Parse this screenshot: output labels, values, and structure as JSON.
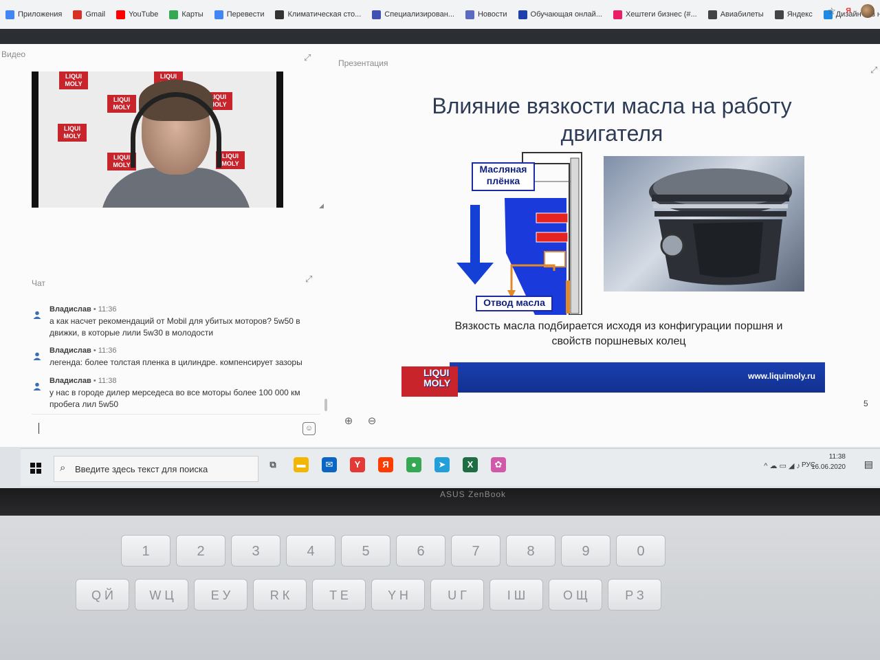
{
  "bookmarks": {
    "items": [
      {
        "label": "Приложения",
        "icon": "apps-grid-icon",
        "color": "#4285f4"
      },
      {
        "label": "Gmail",
        "icon": "gmail-icon",
        "color": "#d93025"
      },
      {
        "label": "YouTube",
        "icon": "youtube-icon",
        "color": "#ff0000"
      },
      {
        "label": "Карты",
        "icon": "maps-icon",
        "color": "#34a853"
      },
      {
        "label": "Перевести",
        "icon": "translate-icon",
        "color": "#4285f4"
      },
      {
        "label": "Климатическая сто...",
        "icon": "site-icon",
        "color": "#333333"
      },
      {
        "label": "Специализирован...",
        "icon": "site-icon",
        "color": "#3f51b5"
      },
      {
        "label": "Новости",
        "icon": "news-icon",
        "color": "#5c6bc0"
      },
      {
        "label": "Обучающая онлай...",
        "icon": "site-icon",
        "color": "#1e40af"
      },
      {
        "label": "Хештеги бизнес (#...",
        "icon": "site-icon",
        "color": "#e91e63"
      },
      {
        "label": "Авиабилеты",
        "icon": "globe-icon",
        "color": "#444444"
      },
      {
        "label": "Яндекс",
        "icon": "globe-icon",
        "color": "#444444"
      },
      {
        "label": "Дизайн без назван...",
        "icon": "canva-icon",
        "color": "#1e88e5"
      }
    ],
    "extension_label": "Я"
  },
  "video_panel": {
    "title": "Видео",
    "banner_text": "LIQUI MOLY"
  },
  "presentation_panel": {
    "title": "Презентация",
    "slide_title": "Влияние вязкости масла на работу двигателя",
    "label_top": "Масляная плёнка",
    "label_bottom": "Отвод масла",
    "caption": "Вязкость масла подбирается исходя из конфигурации поршня и свойств поршневых колец",
    "banner_url": "www.liquimoly.ru",
    "logo_text": "LIQUI MOLY",
    "page_number": "5",
    "zoom_in": "⊕",
    "zoom_out": "⊖"
  },
  "chat": {
    "title": "Чат",
    "messages": [
      {
        "author": "Владислав",
        "time": "11:36",
        "text": "а как насчет рекомендаций от Mobil для убитых моторов? 5w50 в движки, в которые лили 5w30 в молодости"
      },
      {
        "author": "Владислав",
        "time": "11:36",
        "text": "легенда: более толстая пленка в цилиндре. компенсирует зазоры"
      },
      {
        "author": "Владислав",
        "time": "11:38",
        "text": "у нас в городе дилер мерседеса во все моторы более 100 000 км пробега лил 5w50"
      }
    ],
    "input_value": ""
  },
  "taskbar": {
    "search_placeholder": "Введите здесь текст для поиска",
    "lang": "РУС",
    "time": "11:38",
    "date": "16.06.2020",
    "apps": [
      {
        "name": "task-view",
        "glyph": "⧉",
        "color": "#555555"
      },
      {
        "name": "explorer",
        "glyph": "▬",
        "color": "#f2b705"
      },
      {
        "name": "mail",
        "glyph": "✉",
        "color": "#0a66c2"
      },
      {
        "name": "yandex-browser",
        "glyph": "Y",
        "color": "#e53935"
      },
      {
        "name": "yandex",
        "glyph": "Я",
        "color": "#ff3d00"
      },
      {
        "name": "chrome",
        "glyph": "●",
        "color": "#34a853"
      },
      {
        "name": "telegram",
        "glyph": "➤",
        "color": "#229ed9"
      },
      {
        "name": "excel",
        "glyph": "X",
        "color": "#1d6f42"
      },
      {
        "name": "app",
        "glyph": "✿",
        "color": "#d15aa8"
      }
    ]
  },
  "laptop": {
    "brand": "ASUS ZenBook"
  },
  "keyboard": {
    "row_numbers": [
      "1",
      "2",
      "3",
      "4",
      "5",
      "6",
      "7",
      "8",
      "9",
      "0"
    ],
    "row_letters": [
      "Q Й",
      "W Ц",
      "E У",
      "R К",
      "T Е",
      "Y Н",
      "U Г",
      "I Ш",
      "O Щ",
      "P З"
    ]
  }
}
